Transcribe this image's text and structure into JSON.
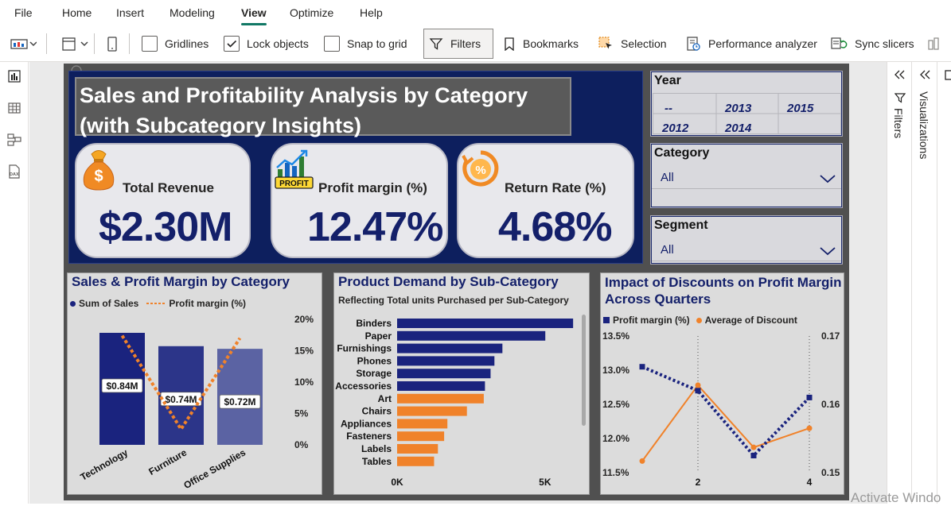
{
  "menu": {
    "items": [
      "File",
      "Home",
      "Insert",
      "Modeling",
      "View",
      "Optimize",
      "Help"
    ],
    "active": "View"
  },
  "toolbar": {
    "gridlines": "Gridlines",
    "gridlines_checked": false,
    "lock_objects": "Lock objects",
    "lock_objects_checked": true,
    "snap_to_grid": "Snap to grid",
    "snap_to_grid_checked": false,
    "filters": "Filters",
    "bookmarks": "Bookmarks",
    "selection": "Selection",
    "performance_analyzer": "Performance analyzer",
    "sync_slicers": "Sync slicers"
  },
  "right_panes": {
    "filters": "Filters",
    "visualizations": "Visualizations"
  },
  "report": {
    "title": "Sales and Profitability Analysis by Category (with Subcategory Insights)",
    "kpis": [
      {
        "label": "Total Revenue",
        "value": "$2.30M",
        "icon": "money-bag-icon"
      },
      {
        "label": "Profit margin (%)",
        "value": "12.47%",
        "icon": "profit-chart-icon",
        "icon_text": "PROFIT"
      },
      {
        "label": "Return Rate (%)",
        "value": "4.68%",
        "icon": "return-percent-icon"
      }
    ],
    "slicers": {
      "year": {
        "title": "Year",
        "options": [
          "--",
          "2013",
          "2015",
          "2012",
          "2014"
        ]
      },
      "category": {
        "title": "Category",
        "value": "All"
      },
      "segment": {
        "title": "Segment",
        "value": "All"
      }
    }
  },
  "chart_data": [
    {
      "type": "bar",
      "title": "Sales & Profit Margin by Category",
      "legend": [
        "Sum of Sales",
        "Profit margin (%)"
      ],
      "categories": [
        "Technology",
        "Furniture",
        "Office Supplies"
      ],
      "series": [
        {
          "name": "Sum of Sales",
          "values": [
            0.84,
            0.74,
            0.72
          ],
          "labels": [
            "$0.84M",
            "$0.74M",
            "$0.72M"
          ],
          "color": "#1a237e"
        },
        {
          "name": "Profit margin (%)",
          "values": [
            17.4,
            2.5,
            17.0
          ],
          "color": "#f0822a"
        }
      ],
      "y2_ticks": [
        "20%",
        "15%",
        "10%",
        "5%",
        "0%"
      ],
      "y2lim": [
        0,
        20
      ]
    },
    {
      "type": "bar",
      "orientation": "horizontal",
      "title": "Product Demand by Sub-Category",
      "subtitle": "Reflecting Total units Purchased per Sub-Category",
      "categories": [
        "Binders",
        "Paper",
        "Furnishings",
        "Phones",
        "Storage",
        "Accessories",
        "Art",
        "Chairs",
        "Appliances",
        "Fasteners",
        "Labels",
        "Tables"
      ],
      "values": [
        5950,
        5010,
        3560,
        3290,
        3160,
        2970,
        2930,
        2360,
        1700,
        1590,
        1380,
        1250
      ],
      "colors": [
        "#1a237e",
        "#1a237e",
        "#1a237e",
        "#1a237e",
        "#1a237e",
        "#1a237e",
        "#f0822a",
        "#f0822a",
        "#f0822a",
        "#f0822a",
        "#f0822a",
        "#f0822a"
      ],
      "x_ticks": [
        "0K",
        "5K"
      ],
      "xlim": [
        0,
        6200
      ]
    },
    {
      "type": "line",
      "title": "Impact of Discounts on Profit Margin Across Quarters",
      "legend": [
        "Profit margin (%)",
        "Average of Discount"
      ],
      "x": [
        1,
        2,
        3,
        4
      ],
      "x_ticks": [
        "2",
        "4"
      ],
      "series": [
        {
          "name": "Profit margin (%)",
          "values": [
            13.05,
            12.7,
            11.75,
            12.6
          ],
          "color": "#1a237e",
          "style": "dotted"
        },
        {
          "name": "Average of Discount",
          "values": [
            0.1517,
            0.1628,
            0.1537,
            0.1565
          ],
          "color": "#f0822a",
          "style": "solid"
        }
      ],
      "y_ticks": [
        "13.5%",
        "13.0%",
        "12.5%",
        "12.0%",
        "11.5%"
      ],
      "ylim": [
        11.5,
        13.5
      ],
      "y2_ticks": [
        "0.17",
        "0.16",
        "0.15"
      ],
      "y2lim": [
        0.15,
        0.17
      ]
    }
  ],
  "watermark": "Activate Windo"
}
